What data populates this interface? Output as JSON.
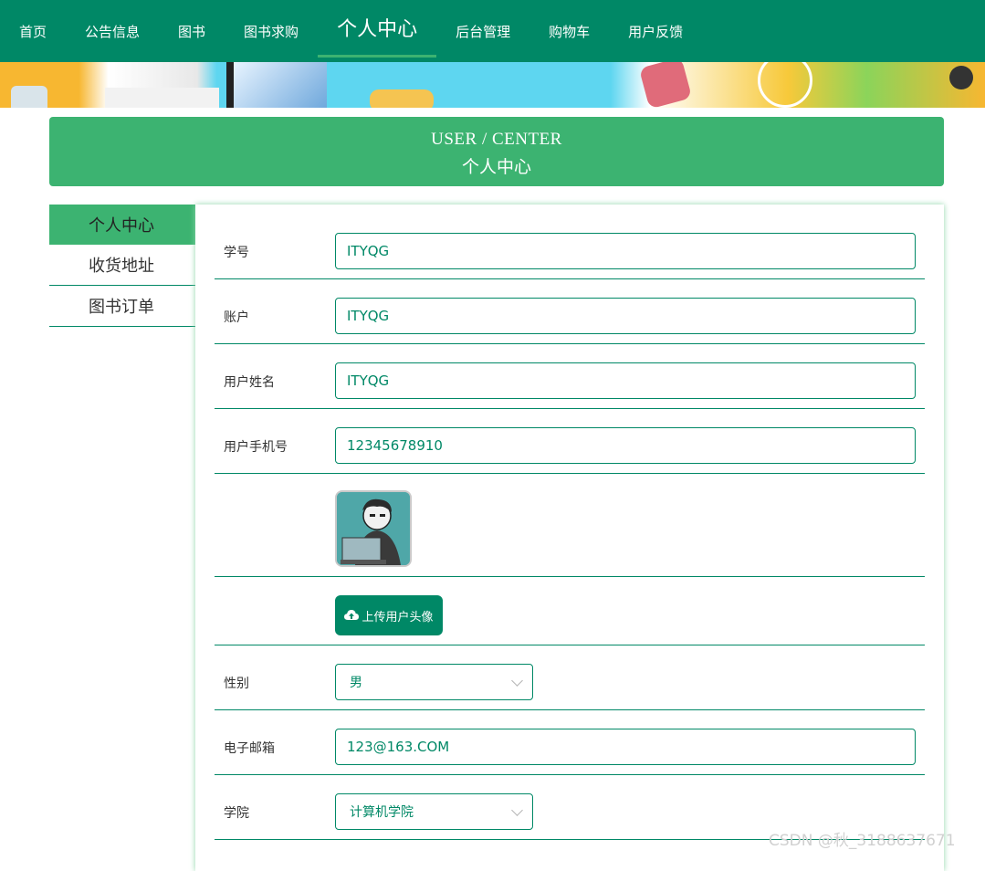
{
  "nav": {
    "items": [
      "首页",
      "公告信息",
      "图书",
      "图书求购",
      "个人中心",
      "后台管理",
      "购物车",
      "用户反馈"
    ],
    "active_index": 4,
    "color": "#008866"
  },
  "header": {
    "title_en": "USER / CENTER",
    "title_cn": "个人中心",
    "color": "#3cb371"
  },
  "sidebar": {
    "items": [
      "个人中心",
      "收货地址",
      "图书订单"
    ],
    "active_index": 0
  },
  "form": {
    "student_id": {
      "label": "学号",
      "value": "ITYQG"
    },
    "account": {
      "label": "账户",
      "value": "ITYQG"
    },
    "username": {
      "label": "用户姓名",
      "value": "ITYQG"
    },
    "phone": {
      "label": "用户手机号",
      "value": "12345678910"
    },
    "upload": {
      "label": "上传用户头像",
      "icon": "cloud-upload-icon"
    },
    "gender": {
      "label": "性别",
      "value": "男"
    },
    "email": {
      "label": "电子邮箱",
      "value": "123@163.COM"
    },
    "college": {
      "label": "学院",
      "value": "计算机学院"
    }
  },
  "watermark": "CSDN @秋_3188637671"
}
